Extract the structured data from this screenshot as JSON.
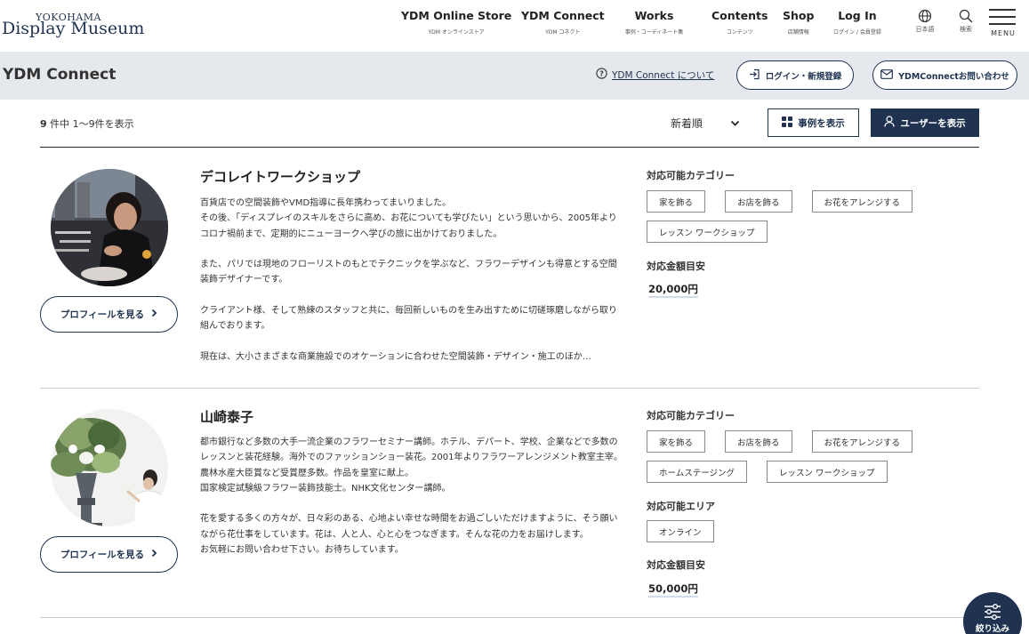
{
  "logo": {
    "top": "YOKOHAMA",
    "main": "Display Museum"
  },
  "nav": [
    {
      "en": "YDM Online Store",
      "jp": "YDM オンラインストア"
    },
    {
      "en": "YDM Connect",
      "jp": "YDM コネクト"
    },
    {
      "en": "Works",
      "jp": "事例・コーディネート集"
    },
    {
      "en": "Contents",
      "jp": "コンテンツ"
    },
    {
      "en": "Shop",
      "jp": "店舗情報"
    },
    {
      "en": "Log In",
      "jp": "ログイン / 会員登録"
    }
  ],
  "lang": {
    "label": "日本語",
    "icon": "globe-icon"
  },
  "search": {
    "label": "検索",
    "icon": "search-icon"
  },
  "menu": {
    "label": "MENU"
  },
  "subheader": {
    "title": "YDM Connect",
    "about_link": "YDM Connect について",
    "login_button": "ログイン・新規登録",
    "contact_button": "YDMConnectお問い合わせ"
  },
  "toolbar": {
    "count_total": "9",
    "count_text": " 件中 1〜9件を表示",
    "sort_label": "新着順",
    "cases_button": "事例を表示",
    "users_button": "ユーザーを表示"
  },
  "profile_button_label": "プロフィールを見る",
  "labels": {
    "category": "対応可能カテゴリー",
    "area": "対応可能エリア",
    "price": "対応金額目安"
  },
  "users": [
    {
      "name": "デコレイトワークショップ",
      "bio": [
        "百貨店での空間装飾やVMD指導に長年携わってまいりました。",
        "その後、「ディスプレイのスキルをさらに高め、お花についても学びたい」という思いから、2005年よりコロナ禍前まで、定期的にニューヨークへ学びの旅に出かけておりました。",
        "",
        "また、パリでは現地のフローリストのもとでテクニックを学ぶなど、フラワーデザインも得意とする空間装飾デザイナーです。",
        "",
        "クライアント様、そして熟練のスタッフと共に、毎回新しいものを生み出すために切磋琢磨しながら取り組んでおります。",
        "",
        "現在は、大小さまざまな商業施設でのオケーションに合わせた空間装飾・デザイン・施工のほか…"
      ],
      "categories": [
        "家を飾る",
        "お店を飾る",
        "お花をアレンジする",
        "レッスン ワークショップ"
      ],
      "areas": [],
      "price": "20,000円"
    },
    {
      "name": "山崎泰子",
      "bio": [
        "都市銀行など多数の大手一流企業のフラワーセミナー講師。ホテル、デパート、学校、企業などで多数のレッスンと装花経験。海外でのファッションショー装花。2001年よりフラワーアレンジメント教室主宰。",
        "農林水産大臣賞など受賞歴多数。作品を皇室に献上。",
        "国家検定試験級フラワー装飾技能士。NHK文化センター講師。",
        "",
        "花を愛する多くの方々が、日々彩のある、心地よい幸せな時間をお過ごしいただけますように、そう願いながら花仕事をしています。花は、人と人、心と心をつなぎます。そんな花の力をお届けします。",
        "お気軽にお問い合わせ下さい。お待ちしています。"
      ],
      "categories": [
        "家を飾る",
        "お店を飾る",
        "お花をアレンジする",
        "ホームステージング",
        "レッスン ワークショップ"
      ],
      "areas": [
        "オンライン"
      ],
      "price": "50,000円"
    }
  ],
  "filter_button": "絞り込み",
  "colors": {
    "navy": "#1f3350",
    "subheader_bg": "#e5e8ec"
  }
}
